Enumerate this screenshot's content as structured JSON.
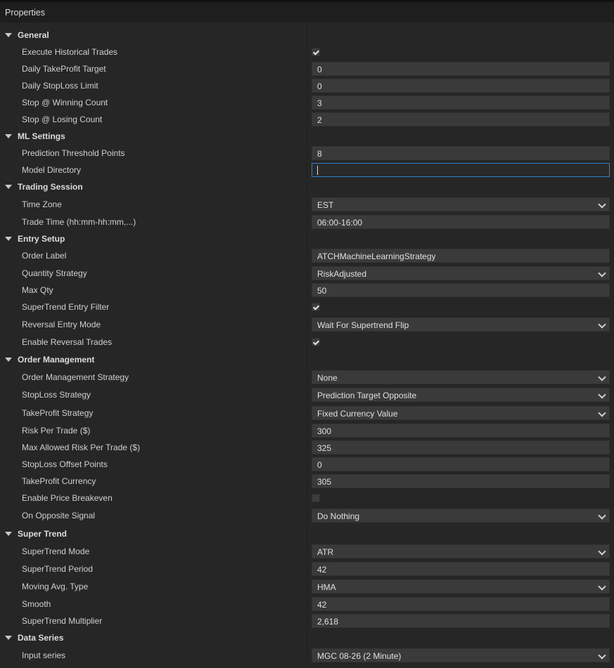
{
  "panel": {
    "title": "Properties"
  },
  "general": {
    "title": "General",
    "execute_historical_trades": {
      "label": "Execute Historical Trades",
      "checked": true
    },
    "daily_takeprofit_target": {
      "label": "Daily TakeProfit Target",
      "value": "0"
    },
    "daily_stoploss_limit": {
      "label": "Daily StopLoss Limit",
      "value": "0"
    },
    "stop_winning_count": {
      "label": "Stop @ Winning Count",
      "value": "3"
    },
    "stop_losing_count": {
      "label": "Stop @ Losing Count",
      "value": "2"
    }
  },
  "ml_settings": {
    "title": "ML Settings",
    "prediction_threshold_points": {
      "label": "Prediction Threshold Points",
      "value": "8"
    },
    "model_directory": {
      "label": "Model Directory",
      "value": ""
    }
  },
  "trading_session": {
    "title": "Trading Session",
    "time_zone": {
      "label": "Time Zone",
      "value": "EST"
    },
    "trade_time": {
      "label": "Trade Time (hh:mm-hh:mm,...)",
      "value": "06:00-16:00"
    }
  },
  "entry_setup": {
    "title": "Entry Setup",
    "order_label": {
      "label": "Order Label",
      "value": "ATCHMachineLearningStrategy"
    },
    "quantity_strategy": {
      "label": "Quantity Strategy",
      "value": "RiskAdjusted"
    },
    "max_qty": {
      "label": "Max Qty",
      "value": "50"
    },
    "supertrend_entry_filter": {
      "label": "SuperTrend Entry Filter",
      "checked": true
    },
    "reversal_entry_mode": {
      "label": "Reversal Entry Mode",
      "value": "Wait For Supertrend Flip"
    },
    "enable_reversal_trades": {
      "label": "Enable Reversal Trades",
      "checked": true
    }
  },
  "order_management": {
    "title": "Order Management",
    "order_management_strategy": {
      "label": "Order Management Strategy",
      "value": "None"
    },
    "stoploss_strategy": {
      "label": "StopLoss Strategy",
      "value": "Prediction Target Opposite"
    },
    "takeprofit_strategy": {
      "label": "TakeProfit Strategy",
      "value": "Fixed Currency Value"
    },
    "risk_per_trade": {
      "label": "Risk Per Trade ($)",
      "value": "300"
    },
    "max_allowed_risk": {
      "label": "Max Allowed Risk Per Trade ($)",
      "value": "325"
    },
    "stoploss_offset_points": {
      "label": "StopLoss Offset Points",
      "value": "0"
    },
    "takeprofit_currency": {
      "label": "TakeProfit Currency",
      "value": "305"
    },
    "enable_price_breakeven": {
      "label": "Enable Price Breakeven",
      "checked": false
    },
    "on_opposite_signal": {
      "label": "On Opposite Signal",
      "value": "Do Nothing"
    }
  },
  "super_trend": {
    "title": "Super Trend",
    "supertrend_mode": {
      "label": "SuperTrend Mode",
      "value": "ATR"
    },
    "supertrend_period": {
      "label": "SuperTrend Period",
      "value": "42"
    },
    "moving_avg_type": {
      "label": "Moving Avg. Type",
      "value": "HMA"
    },
    "smooth": {
      "label": "Smooth",
      "value": "42"
    },
    "supertrend_multiplier": {
      "label": "SuperTrend Multiplier",
      "value": "2,618"
    }
  },
  "data_series": {
    "title": "Data Series",
    "input_series": {
      "label": "Input series",
      "value": "MGC 08-26 (2 Minute)"
    }
  }
}
